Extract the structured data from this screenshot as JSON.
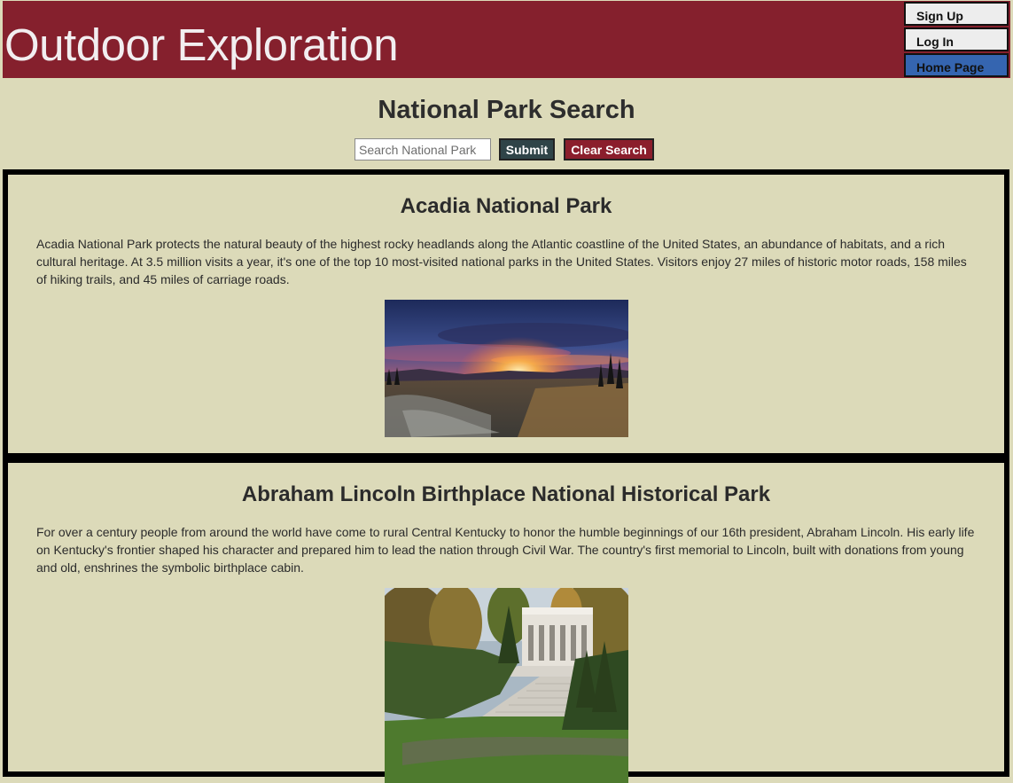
{
  "header": {
    "title": "Outdoor Exploration",
    "nav": {
      "signup": "Sign Up",
      "login": "Log In",
      "home": "Home Page"
    }
  },
  "search": {
    "heading": "National Park Search",
    "placeholder": "Search National Park",
    "value": "",
    "submit_label": "Submit",
    "clear_label": "Clear Search"
  },
  "parks": [
    {
      "name": "Acadia National Park",
      "description": "Acadia National Park protects the natural beauty of the highest rocky headlands along the Atlantic coastline of the United States, an abundance of habitats, and a rich cultural heritage. At 3.5 million visits a year, it's one of the top 10 most-visited national parks in the United States. Visitors enjoy 27 miles of historic motor roads, 158 miles of hiking trails, and 45 miles of carriage roads.",
      "image": "sunset-landscape-photo"
    },
    {
      "name": "Abraham Lincoln Birthplace National Historical Park",
      "description": "For over a century people from around the world have come to rural Central Kentucky to honor the humble beginnings of our 16th president, Abraham Lincoln. His early life on Kentucky's frontier shaped his character and prepared him to lead the nation through Civil War. The country's first memorial to Lincoln, built with donations from young and old, enshrines the symbolic birthplace cabin.",
      "image": "memorial-building-photo"
    }
  ],
  "colors": {
    "background": "#dcdab9",
    "header": "#85202d",
    "submit": "#2f4448",
    "clear": "#8b1e2c",
    "home_button": "#3565b0"
  }
}
